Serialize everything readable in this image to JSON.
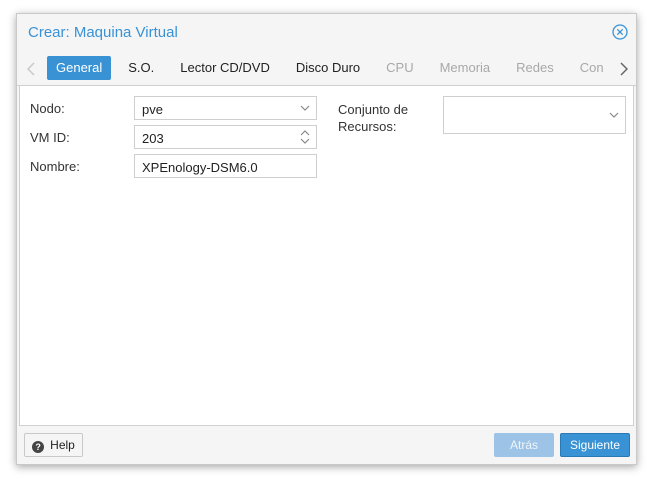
{
  "window": {
    "title": "Crear: Maquina Virtual",
    "close_icon": "close-circle-icon"
  },
  "tabs": [
    {
      "label": "General",
      "state": "active"
    },
    {
      "label": "S.O.",
      "state": "enabled"
    },
    {
      "label": "Lector CD/DVD",
      "state": "enabled"
    },
    {
      "label": "Disco Duro",
      "state": "enabled"
    },
    {
      "label": "CPU",
      "state": "disabled"
    },
    {
      "label": "Memoria",
      "state": "disabled"
    },
    {
      "label": "Redes",
      "state": "disabled"
    },
    {
      "label": "Con",
      "state": "disabled"
    }
  ],
  "form": {
    "node_label": "Nodo:",
    "node_value": "pve",
    "vmid_label": "VM ID:",
    "vmid_value": "203",
    "name_label": "Nombre:",
    "name_value": "XPEnology-DSM6.0",
    "pool_label_line1": "Conjunto de",
    "pool_label_line2": "Recursos:",
    "pool_value": ""
  },
  "footer": {
    "help_label": "Help",
    "back_label": "Atrás",
    "next_label": "Siguiente"
  },
  "colors": {
    "accent": "#3892d4",
    "accent_disabled": "#9dc4e6",
    "disabled_text": "#a8a8a8"
  }
}
